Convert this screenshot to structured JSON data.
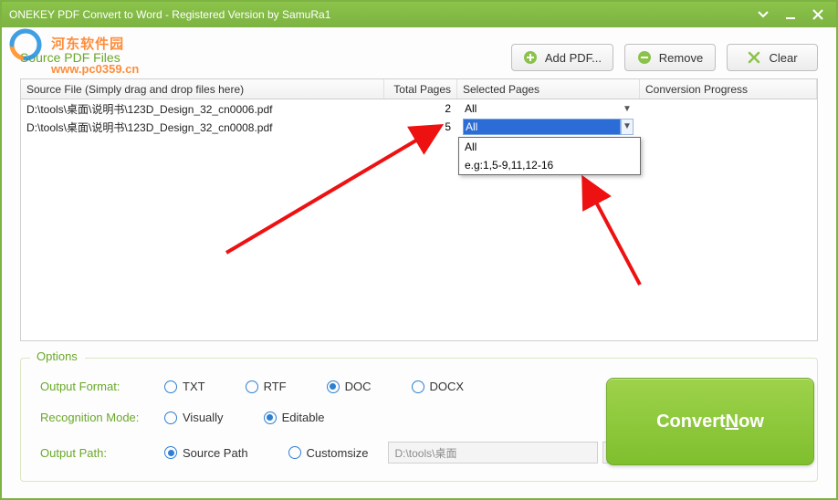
{
  "titlebar": {
    "text": "ONEKEY PDF Convert to Word - Registered Version by SamuRa1"
  },
  "watermark": {
    "site_name": "河东软件园",
    "url": "www.pc0359.cn"
  },
  "source_section": {
    "title": "Source PDF Files"
  },
  "buttons": {
    "add": "Add PDF...",
    "remove": "Remove",
    "clear": "Clear"
  },
  "columns": {
    "file": "Source File (Simply drag and drop files here)",
    "total": "Total Pages",
    "selected": "Selected Pages",
    "progress": "Conversion Progress"
  },
  "rows": [
    {
      "file": "D:\\tools\\桌面\\说明书\\123D_Design_32_cn0006.pdf",
      "total": "2",
      "selected": "All"
    },
    {
      "file": "D:\\tools\\桌面\\说明书\\123D_Design_32_cn0008.pdf",
      "total": "5",
      "selected": "All"
    }
  ],
  "dropdown": {
    "opt1": "All",
    "opt2": "e.g:1,5-9,11,12-16"
  },
  "options": {
    "legend": "Options",
    "format_label": "Output Format:",
    "formats": {
      "txt": "TXT",
      "rtf": "RTF",
      "doc": "DOC",
      "docx": "DOCX"
    },
    "mode_label": "Recognition Mode:",
    "modes": {
      "visually": "Visually",
      "editable": "Editable"
    },
    "path_label": "Output Path:",
    "paths": {
      "source": "Source Path",
      "custom": "Customsize"
    },
    "path_value": "D:\\tools\\桌面"
  },
  "convert": {
    "prefix": "Convert ",
    "underlined": "N",
    "suffix": "ow"
  }
}
